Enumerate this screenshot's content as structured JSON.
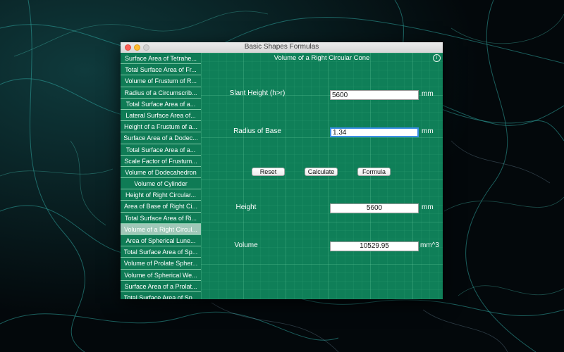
{
  "window": {
    "title": "Basic Shapes Formulas"
  },
  "sidebar": {
    "items": [
      {
        "label": "Surface Area of Tetrahe..."
      },
      {
        "label": "Total Surface Area of Fr..."
      },
      {
        "label": "Volume of Frustum of R..."
      },
      {
        "label": "Radius of a Circumscrib..."
      },
      {
        "label": "Total Surface Area of a..."
      },
      {
        "label": "Lateral Surface Area of..."
      },
      {
        "label": "Height of a Frustum of a..."
      },
      {
        "label": "Surface Area of a Dodec..."
      },
      {
        "label": "Total Surface Area of a..."
      },
      {
        "label": "Scale Factor of Frustum..."
      },
      {
        "label": "Volume of Dodecahedron"
      },
      {
        "label": "Volume of Cylinder"
      },
      {
        "label": "Height of Right Circular..."
      },
      {
        "label": "Area of Base of Right Ci..."
      },
      {
        "label": "Total Surface Area of Ri..."
      },
      {
        "label": "Volume of a Right Circul...",
        "selected": true
      },
      {
        "label": "Area of Spherical Lune..."
      },
      {
        "label": "Total Surface Area of Sp..."
      },
      {
        "label": "Volume of Prolate Spher..."
      },
      {
        "label": "Volume of Spherical We..."
      },
      {
        "label": "Surface Area of a Prolat..."
      },
      {
        "label": "Total Surface Area of Sp..."
      }
    ]
  },
  "content": {
    "title": "Volume of a Right Circular Cone",
    "slant_height": {
      "label": "Slant Height (h>r)",
      "value": "5600",
      "unit": "mm"
    },
    "radius": {
      "label": "Radius of Base",
      "value": "1.34",
      "unit": "mm"
    },
    "buttons": {
      "reset": "Reset",
      "calculate": "Calculate",
      "formula": "Formula"
    },
    "height": {
      "label": "Height",
      "value": "5600",
      "unit": "mm"
    },
    "volume": {
      "label": "Volume",
      "value": "10529.95",
      "unit": "mm^3"
    }
  },
  "colors": {
    "panel": "#0f7f58",
    "selected": "#9fc8b8",
    "focus": "#3b8ee6"
  },
  "icons": {
    "info": "info-icon"
  }
}
